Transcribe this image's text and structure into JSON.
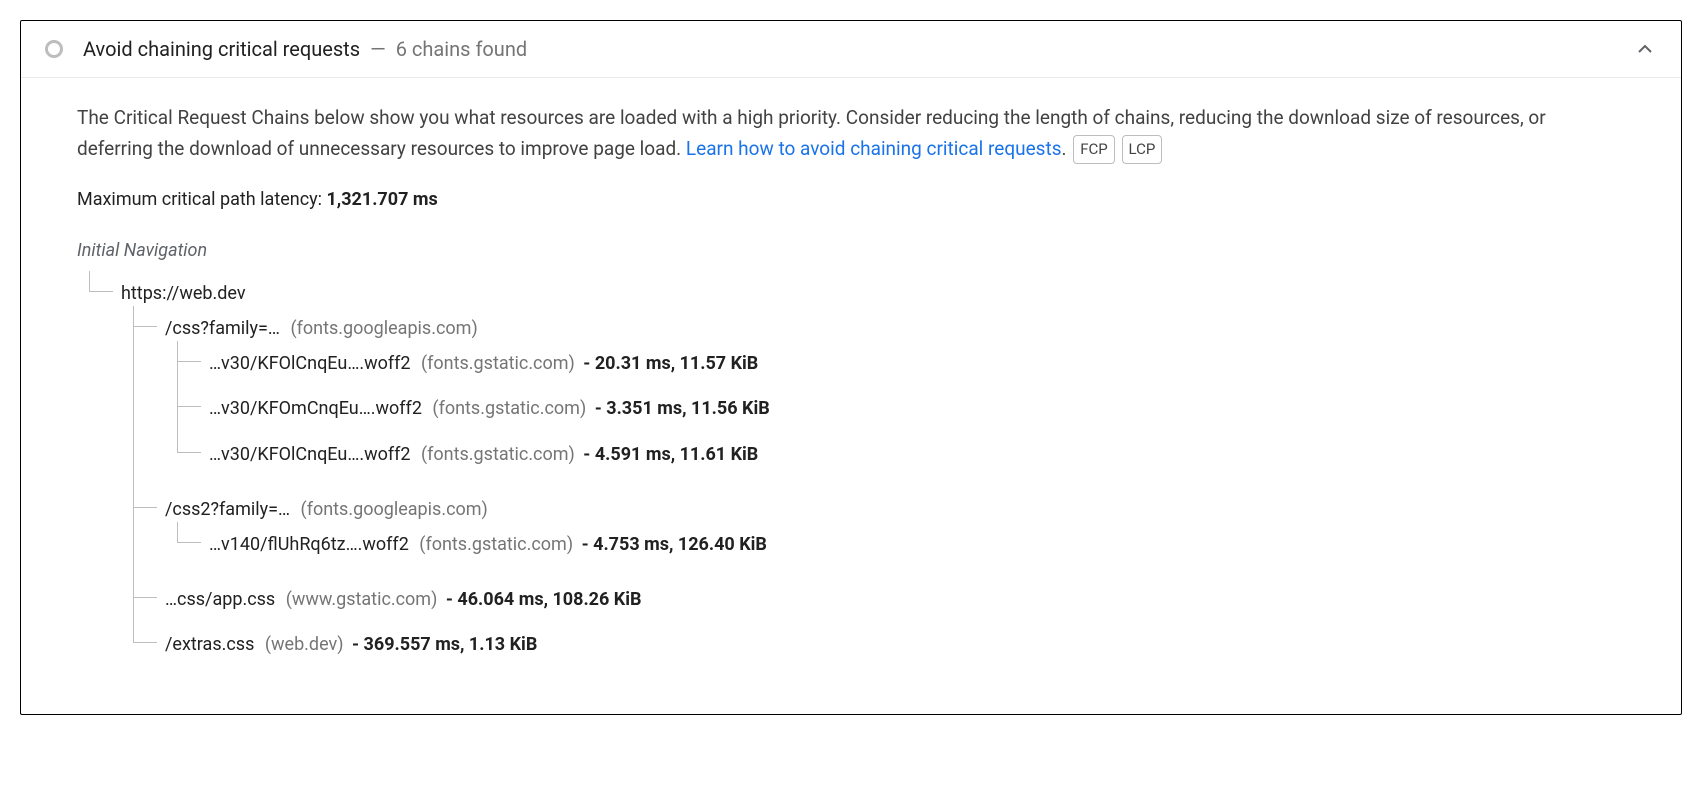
{
  "header": {
    "title": "Avoid chaining critical requests",
    "separator": "—",
    "subtitle": "6 chains found"
  },
  "description": {
    "pre": "The Critical Request Chains below show you what resources are loaded with a high priority. Consider reducing the length of chains, reducing the download size of resources, or deferring the download of unnecessary resources to improve page load. ",
    "link": "Learn how to avoid chaining critical requests",
    "post": "."
  },
  "badges": [
    "FCP",
    "LCP"
  ],
  "maxLatency": {
    "label": "Maximum critical path latency: ",
    "value": "1,321.707 ms"
  },
  "tree": {
    "rootLabel": "Initial Navigation",
    "root": {
      "path": "https://web.dev",
      "host": "",
      "stats": ""
    },
    "children": [
      {
        "path": "/css?family=…",
        "host": "(fonts.googleapis.com)",
        "stats": "",
        "children": [
          {
            "path": "…v30/KFOlCnqEu….woff2",
            "host": "(fonts.gstatic.com)",
            "stats": "- 20.31 ms, 11.57 KiB"
          },
          {
            "path": "…v30/KFOmCnqEu….woff2",
            "host": "(fonts.gstatic.com)",
            "stats": "- 3.351 ms, 11.56 KiB"
          },
          {
            "path": "…v30/KFOlCnqEu….woff2",
            "host": "(fonts.gstatic.com)",
            "stats": "- 4.591 ms, 11.61 KiB"
          }
        ]
      },
      {
        "path": "/css2?family=…",
        "host": "(fonts.googleapis.com)",
        "stats": "",
        "children": [
          {
            "path": "…v140/flUhRq6tz….woff2",
            "host": "(fonts.gstatic.com)",
            "stats": "- 4.753 ms, 126.40 KiB"
          }
        ]
      },
      {
        "path": "…css/app.css",
        "host": "(www.gstatic.com)",
        "stats": "- 46.064 ms, 108.26 KiB"
      },
      {
        "path": "/extras.css",
        "host": "(web.dev)",
        "stats": "- 369.557 ms, 1.13 KiB"
      }
    ]
  }
}
